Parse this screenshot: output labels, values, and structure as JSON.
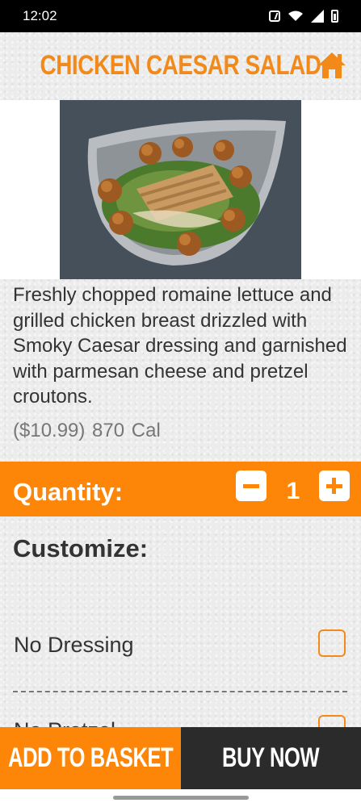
{
  "status_bar": {
    "time": "12:02"
  },
  "header": {
    "title": "CHICKEN CAESAR SALAD"
  },
  "item": {
    "description": "Freshly chopped romaine lettuce and grilled chicken breast drizzled with Smoky Caesar dressing and garnished with parmesan cheese and pretzel croutons.",
    "price_line": "($10.99)  870  Cal"
  },
  "quantity": {
    "label": "Quantity:",
    "value": "1"
  },
  "customize": {
    "heading": "Customize:",
    "options": [
      {
        "label": "No Dressing",
        "checked": false
      },
      {
        "label": "No Pretzel",
        "checked": false
      }
    ]
  },
  "actions": {
    "add_to_basket": "ADD TO BASKET",
    "buy_now": "BUY NOW"
  },
  "colors": {
    "accent": "#fd8609",
    "title": "#f28a1a",
    "dark": "#2b2b2b"
  },
  "icons": {
    "home": "home-icon",
    "minus": "minus-icon",
    "plus": "plus-icon"
  }
}
